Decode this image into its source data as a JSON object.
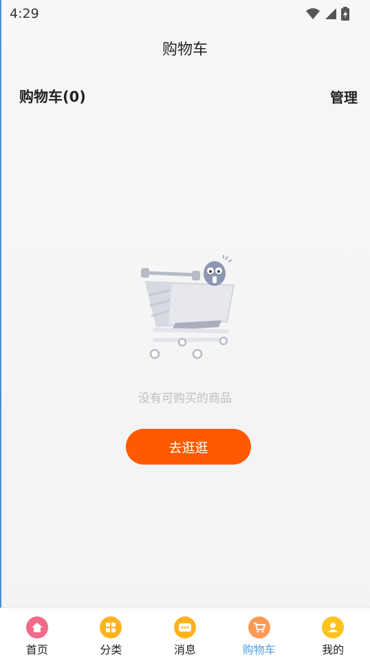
{
  "status_bar": {
    "time": "4:29"
  },
  "header": {
    "title": "购物车"
  },
  "sub_header": {
    "cart_label": "购物车(0)",
    "manage_label": "管理"
  },
  "empty_state": {
    "message": "没有可购买的商品",
    "button_label": "去逛逛"
  },
  "bottom_nav": {
    "items": [
      {
        "label": "首页",
        "icon": "home-icon",
        "color": "#f06a8a",
        "active": false
      },
      {
        "label": "分类",
        "icon": "category-icon",
        "color": "#ffb21e",
        "active": false
      },
      {
        "label": "消息",
        "icon": "message-icon",
        "color": "#ffb21e",
        "active": false
      },
      {
        "label": "购物车",
        "icon": "cart-icon",
        "color": "#ff9a55",
        "active": true
      },
      {
        "label": "我的",
        "icon": "profile-icon",
        "color": "#ffc21e",
        "active": false
      }
    ]
  },
  "colors": {
    "accent": "#ff5a00",
    "active_tab": "#4a9fe3"
  }
}
